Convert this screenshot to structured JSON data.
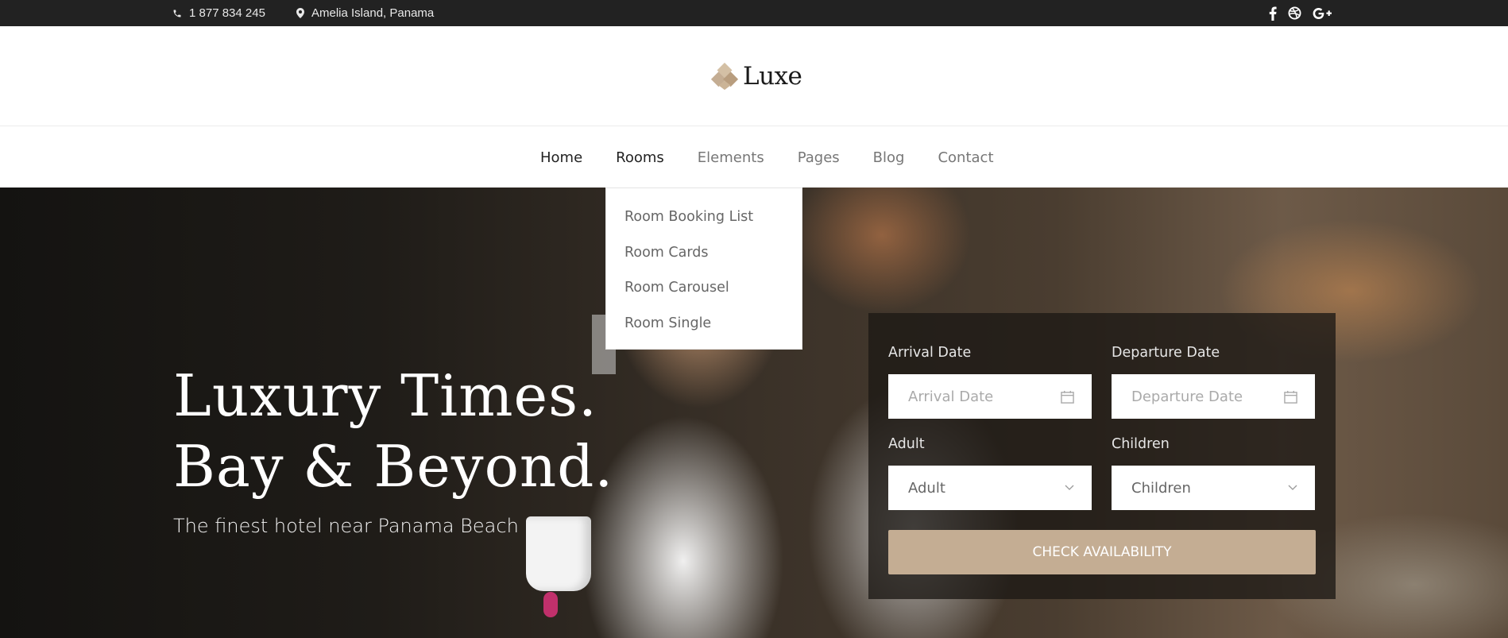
{
  "topbar": {
    "phone": "1 877 834 245",
    "location": "Amelia Island, Panama",
    "social": [
      "facebook-icon",
      "dribbble-icon",
      "google-plus-icon"
    ]
  },
  "logo": {
    "text": "Luxe",
    "icon": "diamond-leaf-icon",
    "accent_color": "#c4ad93"
  },
  "nav": {
    "items": [
      "Home",
      "Rooms",
      "Elements",
      "Pages",
      "Blog",
      "Contact"
    ]
  },
  "dropdown": {
    "items": [
      "Room Booking List",
      "Room Cards",
      "Room Carousel",
      "Room Single"
    ]
  },
  "hero": {
    "title_line1": "Luxury Times.",
    "title_line2": "Bay & Beyond.",
    "subtitle": "The finest hotel near Panama Beach"
  },
  "booking": {
    "arrival_label": "Arrival Date",
    "arrival_placeholder": "Arrival Date",
    "departure_label": "Departure Date",
    "departure_placeholder": "Departure Date",
    "adult_label": "Adult",
    "adult_value": "Adult",
    "children_label": "Children",
    "children_value": "Children",
    "button": "CHECK AVAILABILITY",
    "button_color": "#c4ad93"
  }
}
